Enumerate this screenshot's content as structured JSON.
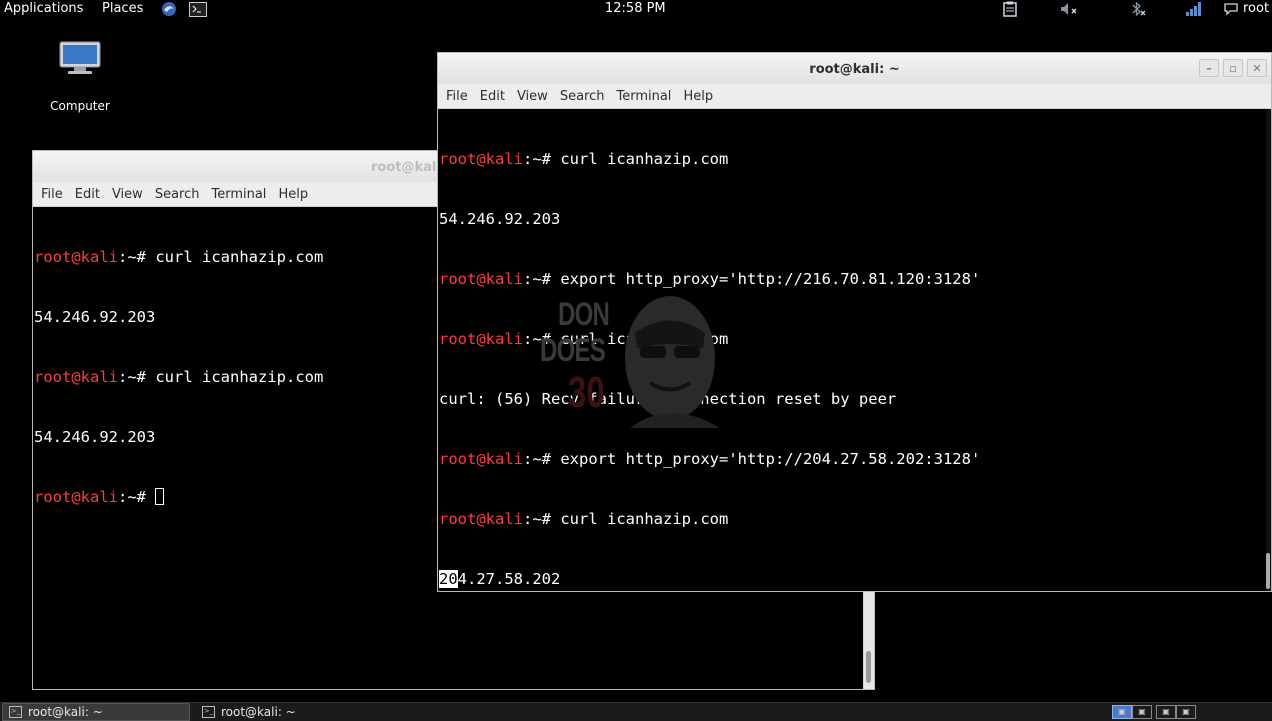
{
  "top_panel": {
    "applications_label": "Applications",
    "places_label": "Places",
    "clock": "12:58 PM",
    "user_label": "root"
  },
  "desktop": {
    "computer_label": "Computer"
  },
  "back_window": {
    "title": "root@kali: ~",
    "menu": [
      "File",
      "Edit",
      "View",
      "Search",
      "Terminal",
      "Help"
    ],
    "prompt_user": "root@kali",
    "prompt_suffix": ":~#",
    "cmd1": "curl icanhazip.com",
    "out1": "54.246.92.203",
    "cmd2": "curl icanhazip.com",
    "out2": "54.246.92.203"
  },
  "front_window": {
    "title": "root@kali: ~",
    "menu": [
      "File",
      "Edit",
      "View",
      "Search",
      "Terminal",
      "Help"
    ],
    "prompt_user": "root@kali",
    "prompt_suffix": ":~#",
    "cmd1": "curl icanhazip.com",
    "out1": "54.246.92.203",
    "cmd2": "export http_proxy='http://216.70.81.120:3128'",
    "cmd3": "curl icanhazip.com",
    "err1": "curl: (56) Recv failure: Connection reset by peer",
    "cmd4": "export http_proxy='http://204.27.58.202:3128'",
    "cmd5": "curl icanhazip.com",
    "out2_selected": "20",
    "out2_rest": "4.27.58.202"
  },
  "watermark": {
    "line1": "DON",
    "line2": "DOES",
    "line3": "30"
  },
  "taskbar": {
    "task1": "root@kali: ~",
    "task2": "root@kali: ~"
  },
  "icons": {
    "top_panel": [
      "kali-dragon-icon",
      "terminal-icon",
      "clipboard-icon",
      "volume-muted-icon",
      "bluetooth-off-icon",
      "network-signal-icon",
      "chat-icon"
    ],
    "window_controls": [
      "minimize-icon",
      "maximize-icon",
      "close-icon"
    ]
  },
  "colors": {
    "prompt_red": "#ff3b3b",
    "terminal_bg": "#000000",
    "titlebar": "#e8e8e8"
  }
}
